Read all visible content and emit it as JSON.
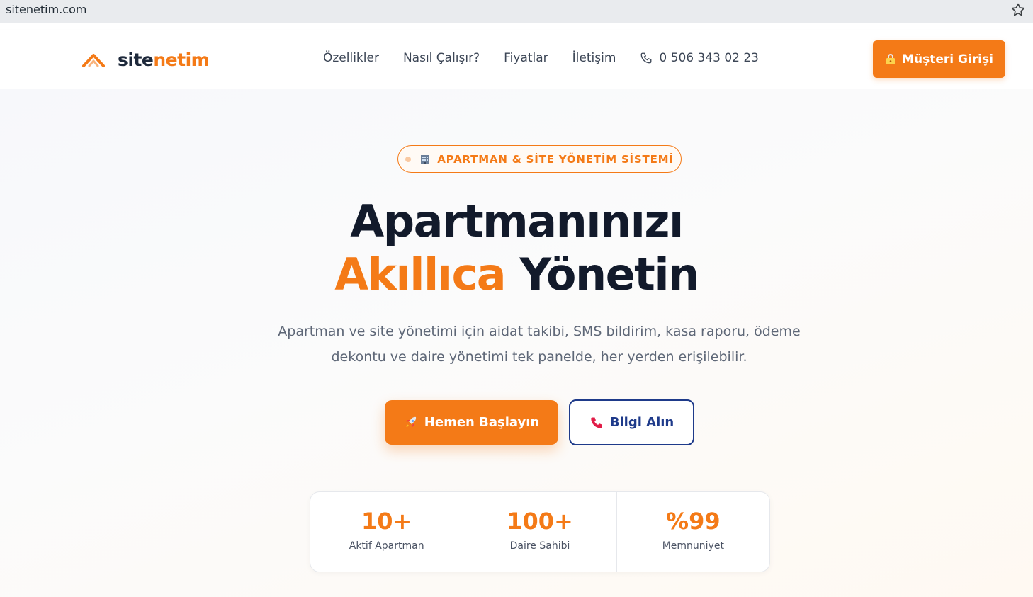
{
  "browser": {
    "url": "sitenetim.com"
  },
  "header": {
    "logo_part1": "site",
    "logo_part2": "netim",
    "nav": [
      "Özellikler",
      "Nasıl Çalışır?",
      "Fiyatlar",
      "İletişim"
    ],
    "phone": "0 506 343 02 23",
    "login_label": "Müşteri Girişi"
  },
  "hero": {
    "badge": "APARTMAN & SİTE YÖNETİM SİSTEMİ",
    "headline_line1": "Apartmanınızı",
    "headline_accent": "Akıllıca",
    "headline_rest": " Yönetin",
    "subtitle": "Apartman ve site yönetimi için aidat takibi, SMS bildirim, kasa raporu, ödeme dekontu ve daire yönetimi tek panelde, her yerden erişilebilir.",
    "primary_cta": "Hemen Başlayın",
    "secondary_cta": "Bilgi Alın"
  },
  "stats": [
    {
      "value": "10+",
      "label": "Aktif Apartman"
    },
    {
      "value": "100+",
      "label": "Daire Sahibi"
    },
    {
      "value": "%99",
      "label": "Memnuniyet"
    }
  ],
  "icons": {
    "logo": "house-roof-icon",
    "bookmark": "star-icon",
    "phone": "phone-icon",
    "login": "lock-icon",
    "badge": "building-icon",
    "primary": "rocket-icon",
    "secondary": "phone-receiver-icon"
  },
  "colors": {
    "accent": "#f47a17",
    "navy": "#1e3a8a",
    "dark": "#121a2b"
  }
}
